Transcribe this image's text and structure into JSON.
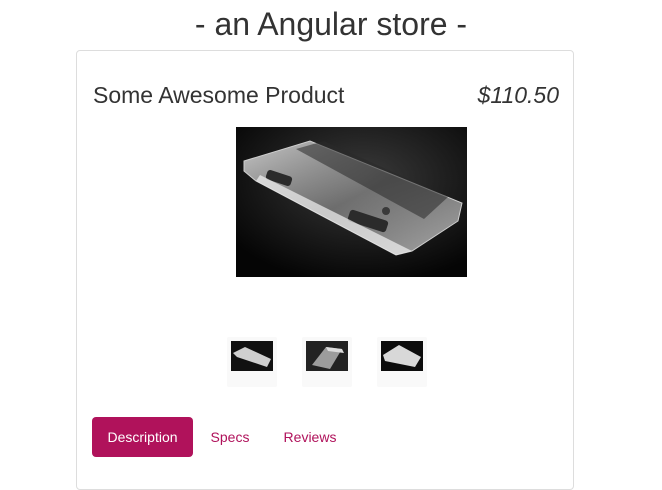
{
  "store": {
    "title": "- an Angular store -"
  },
  "product": {
    "name": "Some Awesome Product",
    "price": "$110.50",
    "image_icon": "glass-keyboard-product-image",
    "thumbnails": [
      "thumbnail-1",
      "thumbnail-2",
      "thumbnail-3"
    ]
  },
  "tabs": [
    {
      "label": "Description",
      "active": true
    },
    {
      "label": "Specs",
      "active": false
    },
    {
      "label": "Reviews",
      "active": false
    }
  ],
  "colors": {
    "accent": "#b0125b",
    "text": "#333333",
    "border": "#dddddd"
  }
}
